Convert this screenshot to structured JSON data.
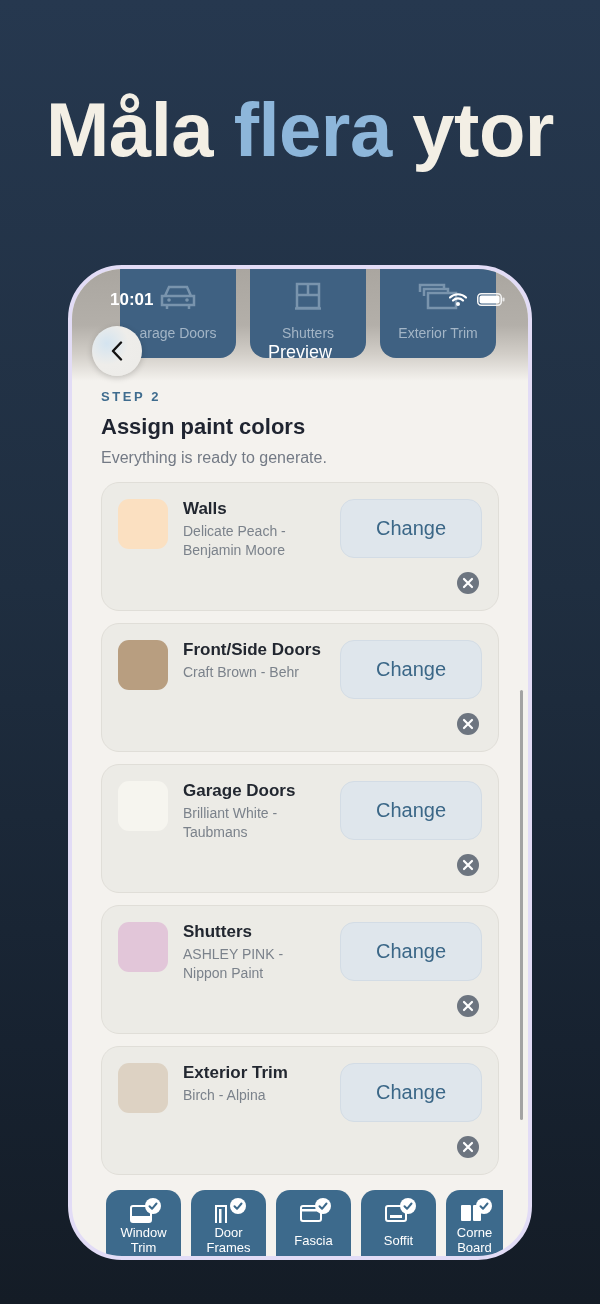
{
  "headline": [
    {
      "text": "Måla",
      "highlight": false
    },
    {
      "text": "flera",
      "highlight": true
    },
    {
      "text": "ytor",
      "highlight": false
    }
  ],
  "status_bar": {
    "time": "10:01"
  },
  "header": {
    "title": "Preview",
    "tiles": [
      {
        "label": "arage Doors",
        "kind": "car"
      },
      {
        "label": "Shutters",
        "kind": "window"
      },
      {
        "label": "Exterior Trim",
        "kind": "layers"
      }
    ]
  },
  "step": {
    "label": "STEP 2",
    "title": "Assign paint colors",
    "subtitle": "Everything is ready to generate."
  },
  "assignments": [
    {
      "surface": "Walls",
      "paint": "Delicate Peach - Benjamin Moore",
      "color": "#fbe0c1",
      "action": "Change"
    },
    {
      "surface": "Front/Side Doors",
      "paint": "Craft Brown - Behr",
      "color": "#b89e80",
      "action": "Change"
    },
    {
      "surface": "Garage Doors",
      "paint": "Brilliant White - Taubmans",
      "color": "#f6f5ef",
      "action": "Change"
    },
    {
      "surface": "Shutters",
      "paint": "ASHLEY PINK - Nippon Paint",
      "color": "#e2c6d9",
      "action": "Change"
    },
    {
      "surface": "Exterior Trim",
      "paint": "Birch - Alpina",
      "color": "#ddd2c3",
      "action": "Change"
    }
  ],
  "surface_tiles": [
    {
      "label": "Window Trim",
      "kind": "window-trim",
      "checked": true
    },
    {
      "label": "Door Frames",
      "kind": "door",
      "checked": true
    },
    {
      "label": "Fascia",
      "kind": "fascia",
      "checked": true
    },
    {
      "label": "Soffit",
      "kind": "soffit",
      "checked": true
    },
    {
      "label": "Corne Board",
      "kind": "corner",
      "checked": true
    }
  ]
}
